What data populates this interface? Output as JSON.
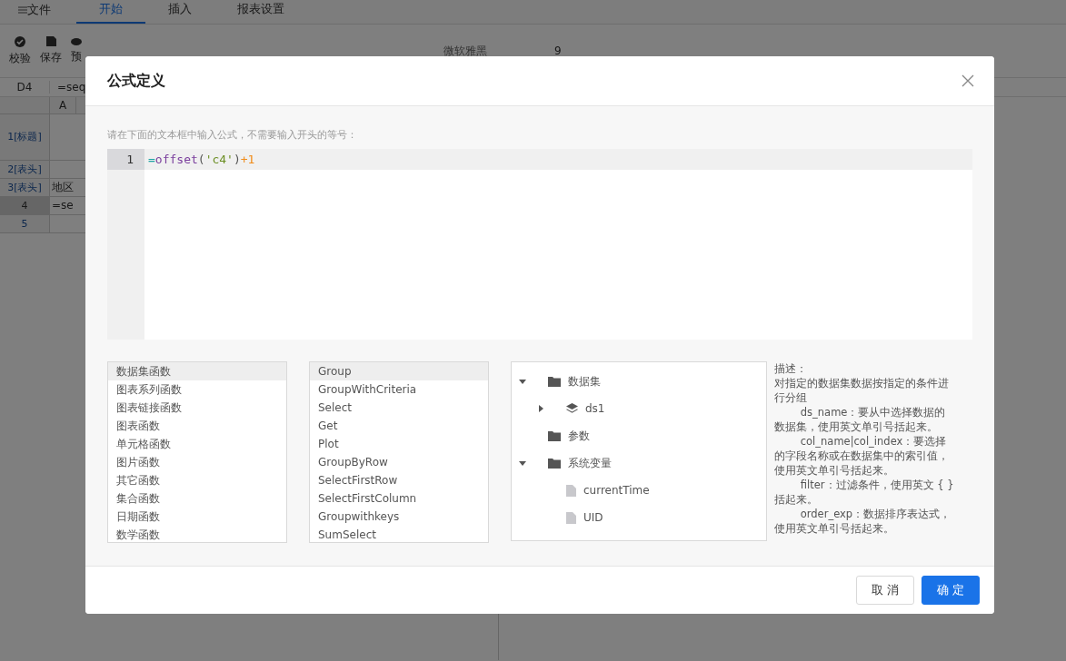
{
  "menu": {
    "file": "文件",
    "tabs": [
      {
        "label": "开始",
        "selected": true
      },
      {
        "label": "插入",
        "selected": false
      },
      {
        "label": "报表设置",
        "selected": false
      }
    ]
  },
  "toolbar": {
    "buttons": [
      {
        "label": "校验"
      },
      {
        "label": "保存"
      },
      {
        "label": "预"
      }
    ],
    "font": "微软雅黑",
    "font_size": "9"
  },
  "formula_bar": {
    "cell": "D4",
    "value": "=seq"
  },
  "sheet": {
    "column": "A",
    "rows": [
      {
        "header": "1[标题]",
        "cells": []
      },
      {
        "header": "2[表头]",
        "cells": []
      },
      {
        "header": "3[表头]",
        "cells": [
          "地区"
        ]
      },
      {
        "header": "4",
        "selected": true,
        "cells": [
          "=se"
        ]
      },
      {
        "header": "5",
        "selected": false,
        "cells": []
      }
    ]
  },
  "dialog": {
    "title": "公式定义",
    "hint": "请在下面的文本框中输入公式，不需要输入开头的等号：",
    "editor": {
      "line_number": "1",
      "tokens": [
        {
          "text": "=",
          "kind": "operator"
        },
        {
          "text": "offset",
          "kind": "function"
        },
        {
          "text": "(",
          "kind": "punct"
        },
        {
          "text": "'c4'",
          "kind": "string"
        },
        {
          "text": ")",
          "kind": "punct"
        },
        {
          "text": "+1",
          "kind": "number"
        }
      ]
    },
    "categories": [
      {
        "label": "数据集函数",
        "selected": true
      },
      {
        "label": "图表系列函数",
        "selected": false
      },
      {
        "label": "图表链接函数",
        "selected": false
      },
      {
        "label": "图表函数",
        "selected": false
      },
      {
        "label": "单元格函数",
        "selected": false
      },
      {
        "label": "图片函数",
        "selected": false
      },
      {
        "label": "其它函数",
        "selected": false
      },
      {
        "label": "集合函数",
        "selected": false
      },
      {
        "label": "日期函数",
        "selected": false
      },
      {
        "label": "数学函数",
        "selected": false
      }
    ],
    "functions": [
      {
        "label": "Group",
        "selected": true
      },
      {
        "label": "GroupWithCriteria",
        "selected": false
      },
      {
        "label": "Select",
        "selected": false
      },
      {
        "label": "Get",
        "selected": false
      },
      {
        "label": "Plot",
        "selected": false
      },
      {
        "label": "GroupByRow",
        "selected": false
      },
      {
        "label": "SelectFirstRow",
        "selected": false
      },
      {
        "label": "SelectFirstColumn",
        "selected": false
      },
      {
        "label": "Groupwithkeys",
        "selected": false
      },
      {
        "label": "SumSelect",
        "selected": false
      }
    ],
    "tree": [
      {
        "label": "数据集",
        "kind": "folder",
        "expanded": true,
        "children": [
          {
            "label": "ds1",
            "kind": "dataset",
            "expanded": false
          }
        ]
      },
      {
        "label": "参数",
        "kind": "folder"
      },
      {
        "label": "系统变量",
        "kind": "folder",
        "expanded": true,
        "children": [
          {
            "label": "currentTime",
            "kind": "file"
          },
          {
            "label": "UID",
            "kind": "file"
          }
        ]
      }
    ],
    "description": [
      {
        "text": "描述：",
        "indent": false
      },
      {
        "text": "对指定的数据集数据按指定的条件进行分组",
        "indent": false
      },
      {
        "text": "ds_name：要从中选择数据的数据集，使用英文单引号括起来。",
        "indent": true
      },
      {
        "text": "col_name|col_index：要选择的字段名称或在数据集中的索引值，使用英文单引号括起来。",
        "indent": true
      },
      {
        "text": "filter：过滤条件，使用英文 { } 括起来。",
        "indent": true
      },
      {
        "text": "order_exp：数据排序表达式，使用英文单引号括起来。",
        "indent": true
      }
    ],
    "buttons": [
      {
        "label": "取 消",
        "kind": "secondary"
      },
      {
        "label": "确 定",
        "kind": "primary"
      }
    ]
  }
}
